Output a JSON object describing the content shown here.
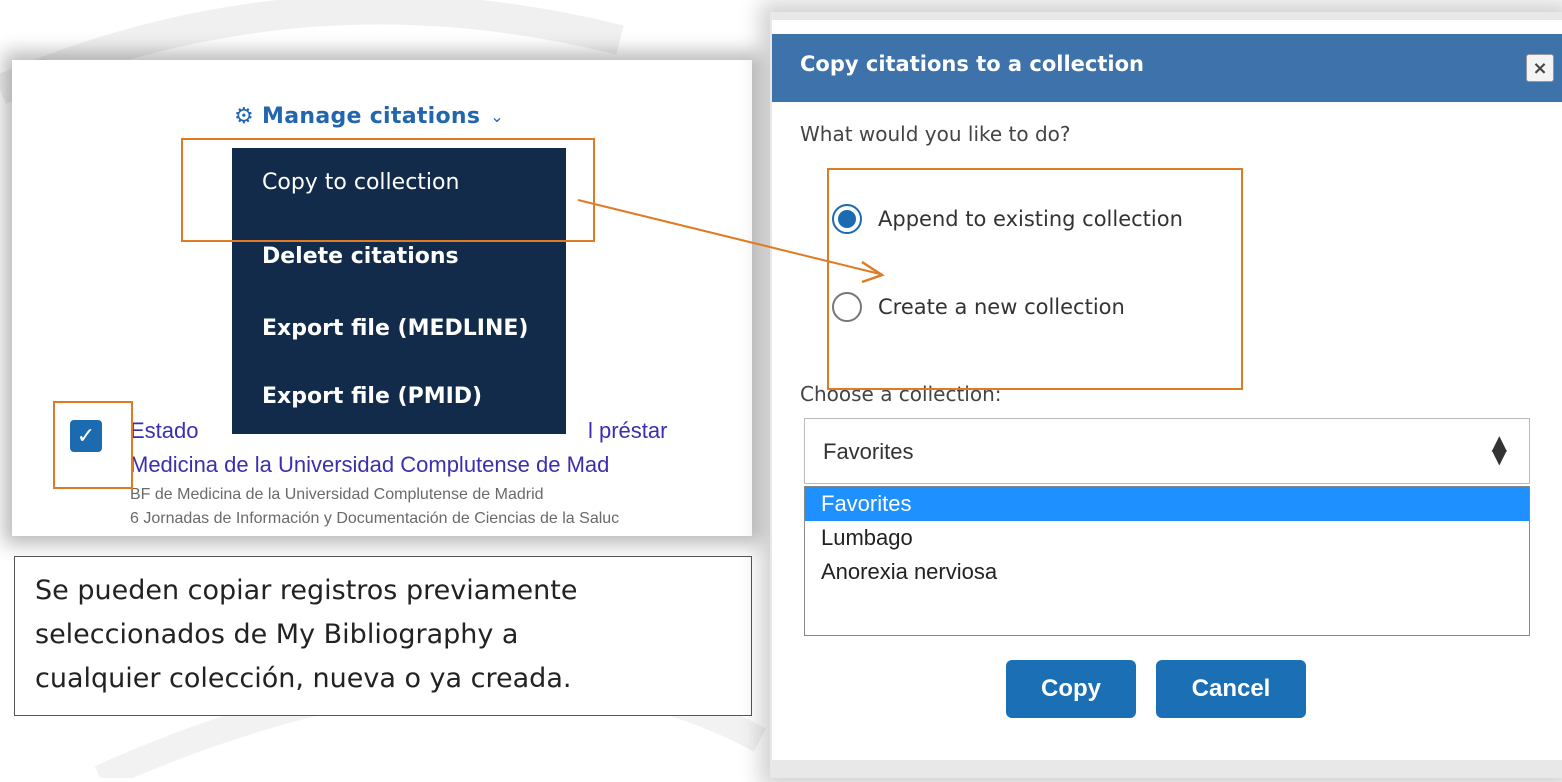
{
  "left_panel": {
    "manage_label": "Manage citations",
    "menu_items": [
      "Copy to collection",
      "Delete citations",
      "Export file (MEDLINE)",
      "Export file (PMID)"
    ],
    "result": {
      "title_line1_start": "Estado",
      "title_line1_end": "l préstar",
      "title_line2": "Medicina de la Universidad Complutense de Mad",
      "meta_line1": "BF de Medicina de la Universidad Complutense de Madrid",
      "meta_line2": "6 Jornadas de Información y Documentación de Ciencias de la Saluc"
    }
  },
  "caption": {
    "line1": "Se pueden copiar registros previamente",
    "line2": "seleccionados de My Bibliography a",
    "line3": "cualquier colección, nueva o ya creada."
  },
  "dialog": {
    "title": "Copy citations to a collection",
    "close_label": "×",
    "question": "What would you like to do?",
    "options": {
      "append": "Append to existing collection",
      "create": "Create a new collection"
    },
    "choose_label": "Choose a collection:",
    "selected_collection": "Favorites",
    "collections": [
      "Favorites",
      "Lumbago",
      "Anorexia nerviosa"
    ],
    "copy_label": "Copy",
    "cancel_label": "Cancel"
  },
  "colors": {
    "header_blue": "#3d73aa",
    "menu_navy": "#122b4a",
    "button_blue": "#1a6fb5",
    "highlight_orange": "#e07b25",
    "option_selected": "#1e90ff"
  }
}
